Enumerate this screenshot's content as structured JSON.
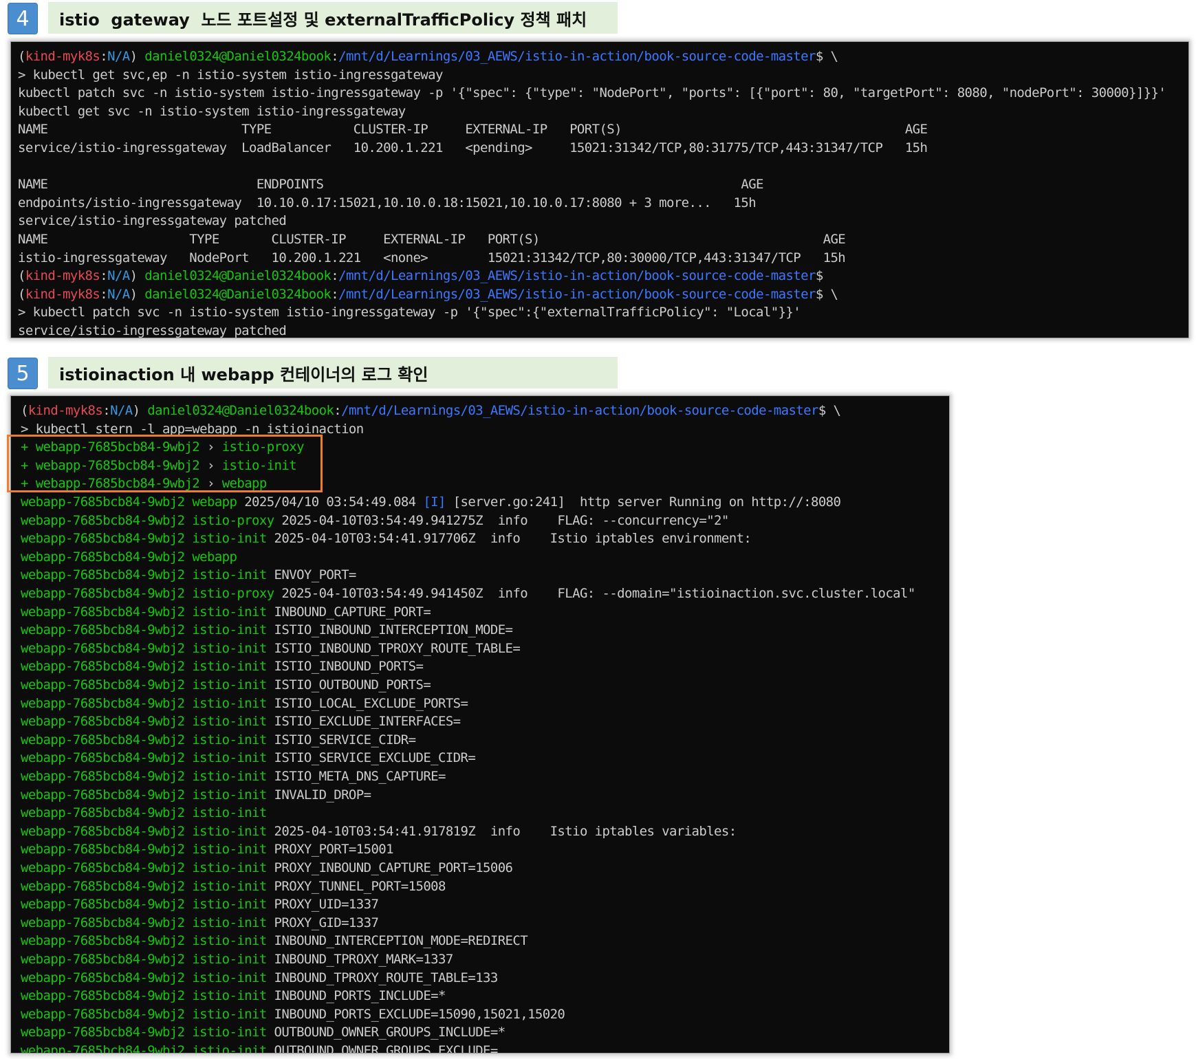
{
  "section4": {
    "number": "4",
    "title": "istio  gateway  노드 포트설정 및 externalTrafficPolicy 정책 패치"
  },
  "section5": {
    "number": "5",
    "title": "istioinaction 내 webapp 컨테이너의 로그 확인"
  },
  "prompt": {
    "ctx": "kind-myk8s",
    "ns": "N/A",
    "user": "daniel0324@Daniel0324book",
    "path": "/mnt/d/Learnings/03_AEWS/istio-in-action/book-source-code-master"
  },
  "term4": {
    "lines": [
      "> kubectl get svc,ep -n istio-system istio-ingressgateway",
      "kubectl patch svc -n istio-system istio-ingressgateway -p '{\"spec\": {\"type\": \"NodePort\", \"ports\": [{\"port\": 80, \"targetPort\": 8080, \"nodePort\": 30000}]}}'",
      "kubectl get svc -n istio-system istio-ingressgateway",
      "NAME                          TYPE           CLUSTER-IP     EXTERNAL-IP   PORT(S)                                      AGE",
      "service/istio-ingressgateway  LoadBalancer   10.200.1.221   <pending>     15021:31342/TCP,80:31775/TCP,443:31347/TCP   15h",
      "",
      "NAME                            ENDPOINTS                                                        AGE",
      "endpoints/istio-ingressgateway  10.10.0.17:15021,10.10.0.18:15021,10.10.0.17:8080 + 3 more...   15h",
      "service/istio-ingressgateway patched",
      "NAME                   TYPE       CLUSTER-IP     EXTERNAL-IP   PORT(S)                                      AGE",
      "istio-ingressgateway   NodePort   10.200.1.221   <none>        15021:31342/TCP,80:30000/TCP,443:31347/TCP   15h"
    ],
    "patch_cmd": "> kubectl patch svc -n istio-system istio-ingressgateway -p '{\"spec\":{\"externalTrafficPolicy\": \"Local\"}}'",
    "patch_result": "service/istio-ingressgateway patched"
  },
  "term5": {
    "cmd": "> kubectl stern -l app=webapp -n istioinaction",
    "pod": "webapp-7685bcb84-9wbj2",
    "added": [
      {
        "prefix": "+ ",
        "container": "istio-proxy"
      },
      {
        "prefix": "+ ",
        "container": "istio-init"
      },
      {
        "prefix": "+ ",
        "container": "webapp"
      }
    ],
    "logs": [
      {
        "c": "webapp",
        "t": "2025/04/10 03:54:49.084 ",
        "tag": "[I]",
        "rest": " [server.go:241]  http server Running on http://:8080"
      },
      {
        "c": "istio-proxy",
        "t": "2025-04-10T03:54:49.941275Z  info    FLAG: --concurrency=\"2\""
      },
      {
        "c": "istio-init",
        "t": "2025-04-10T03:54:41.917706Z  info    Istio iptables environment:"
      },
      {
        "c": "webapp",
        "t": ""
      },
      {
        "c": "istio-init",
        "t": "ENVOY_PORT="
      },
      {
        "c": "istio-proxy",
        "t": "2025-04-10T03:54:49.941450Z  info    FLAG: --domain=\"istioinaction.svc.cluster.local\""
      },
      {
        "c": "istio-init",
        "t": "INBOUND_CAPTURE_PORT="
      },
      {
        "c": "istio-init",
        "t": "ISTIO_INBOUND_INTERCEPTION_MODE="
      },
      {
        "c": "istio-init",
        "t": "ISTIO_INBOUND_TPROXY_ROUTE_TABLE="
      },
      {
        "c": "istio-init",
        "t": "ISTIO_INBOUND_PORTS="
      },
      {
        "c": "istio-init",
        "t": "ISTIO_OUTBOUND_PORTS="
      },
      {
        "c": "istio-init",
        "t": "ISTIO_LOCAL_EXCLUDE_PORTS="
      },
      {
        "c": "istio-init",
        "t": "ISTIO_EXCLUDE_INTERFACES="
      },
      {
        "c": "istio-init",
        "t": "ISTIO_SERVICE_CIDR="
      },
      {
        "c": "istio-init",
        "t": "ISTIO_SERVICE_EXCLUDE_CIDR="
      },
      {
        "c": "istio-init",
        "t": "ISTIO_META_DNS_CAPTURE="
      },
      {
        "c": "istio-init",
        "t": "INVALID_DROP="
      },
      {
        "c": "istio-init",
        "t": ""
      },
      {
        "c": "istio-init",
        "t": "2025-04-10T03:54:41.917819Z  info    Istio iptables variables:"
      },
      {
        "c": "istio-init",
        "t": "PROXY_PORT=15001"
      },
      {
        "c": "istio-init",
        "t": "PROXY_INBOUND_CAPTURE_PORT=15006"
      },
      {
        "c": "istio-init",
        "t": "PROXY_TUNNEL_PORT=15008"
      },
      {
        "c": "istio-init",
        "t": "PROXY_UID=1337"
      },
      {
        "c": "istio-init",
        "t": "PROXY_GID=1337"
      },
      {
        "c": "istio-init",
        "t": "INBOUND_INTERCEPTION_MODE=REDIRECT"
      },
      {
        "c": "istio-init",
        "t": "INBOUND_TPROXY_MARK=1337"
      },
      {
        "c": "istio-init",
        "t": "INBOUND_TPROXY_ROUTE_TABLE=133"
      },
      {
        "c": "istio-init",
        "t": "INBOUND_PORTS_INCLUDE=*"
      },
      {
        "c": "istio-init",
        "t": "INBOUND_PORTS_EXCLUDE=15090,15021,15020"
      },
      {
        "c": "istio-init",
        "t": "OUTBOUND_OWNER_GROUPS_INCLUDE=*"
      },
      {
        "c": "istio-init",
        "t": "OUTBOUND_OWNER_GROUPS_EXCLUDE="
      }
    ]
  }
}
